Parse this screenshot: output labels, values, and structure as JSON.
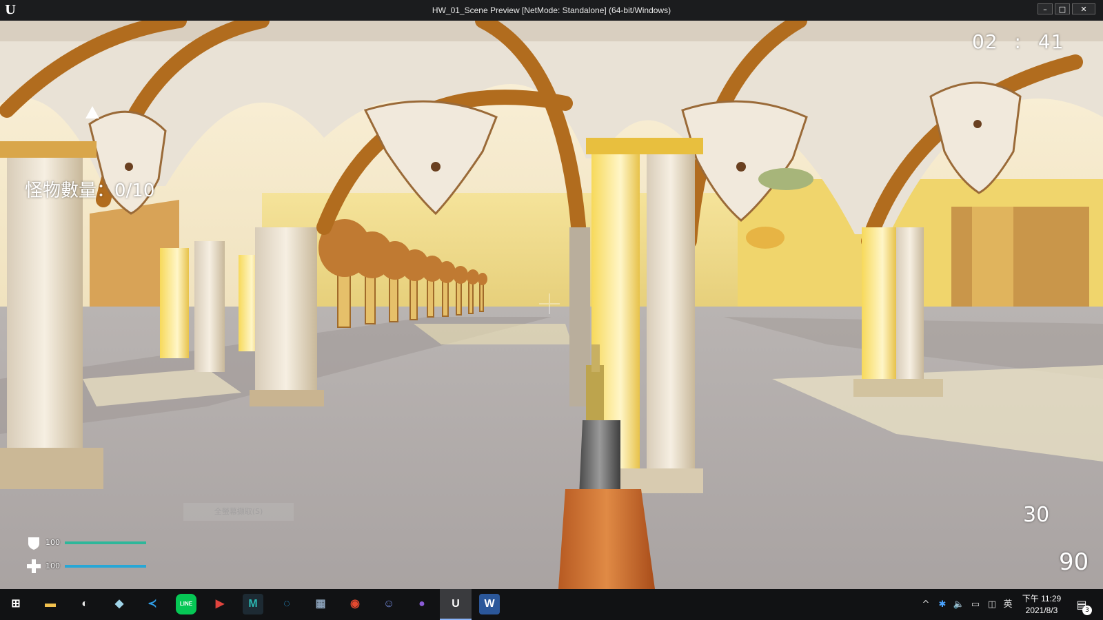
{
  "window": {
    "title": "HW_01_Scene Preview [NetMode: Standalone]  (64-bit/Windows)",
    "app_logo": "U",
    "controls": {
      "minimize": "–",
      "maximize": "□",
      "close": "✕"
    }
  },
  "hud": {
    "timer": {
      "minutes": "02",
      "separator": ":",
      "seconds": "41"
    },
    "monster_count_label": "怪物數量：0/10",
    "ghost_button_text": "全螢幕擷取(S)",
    "ammo_in_magazine": "30",
    "ammo_reserve": "90",
    "armor": {
      "value": "100",
      "fill": 1.0,
      "color": "#2eb79a",
      "icon": "shield-icon"
    },
    "health": {
      "value": "100",
      "fill": 1.0,
      "color": "#27a7d6",
      "icon": "health-cross-icon"
    }
  },
  "taskbar": {
    "apps": [
      {
        "name": "start",
        "glyph": "⊞",
        "color": "#ffffff"
      },
      {
        "name": "file-explorer",
        "glyph": "▬",
        "color": "#f2c14e"
      },
      {
        "name": "paint",
        "glyph": "◐",
        "color": "#e8e8e8"
      },
      {
        "name": "notes",
        "glyph": "◆",
        "color": "#9fd3e8"
      },
      {
        "name": "vscode",
        "glyph": "≺",
        "color": "#2f9ee8"
      },
      {
        "name": "line",
        "glyph": "LINE",
        "color": "#06c755"
      },
      {
        "name": "presenter",
        "glyph": "▶",
        "color": "#e0443e"
      },
      {
        "name": "maya",
        "glyph": "M",
        "color": "#2bb6b1"
      },
      {
        "name": "edge",
        "glyph": "◌",
        "color": "#2ba5e8"
      },
      {
        "name": "calculator",
        "glyph": "▦",
        "color": "#8aa0b8"
      },
      {
        "name": "chrome",
        "glyph": "◉",
        "color": "#e4492f"
      },
      {
        "name": "discord",
        "glyph": "☺",
        "color": "#7289da"
      },
      {
        "name": "github",
        "glyph": "●",
        "color": "#8a5bd6"
      },
      {
        "name": "unreal",
        "glyph": "U",
        "color": "#ffffff"
      },
      {
        "name": "word",
        "glyph": "W",
        "color": "#2b579a"
      }
    ],
    "tray": {
      "chevron": "^",
      "ime": "英",
      "time": "下午 11:29",
      "date": "2021/8/3",
      "notification_count": "3"
    }
  }
}
